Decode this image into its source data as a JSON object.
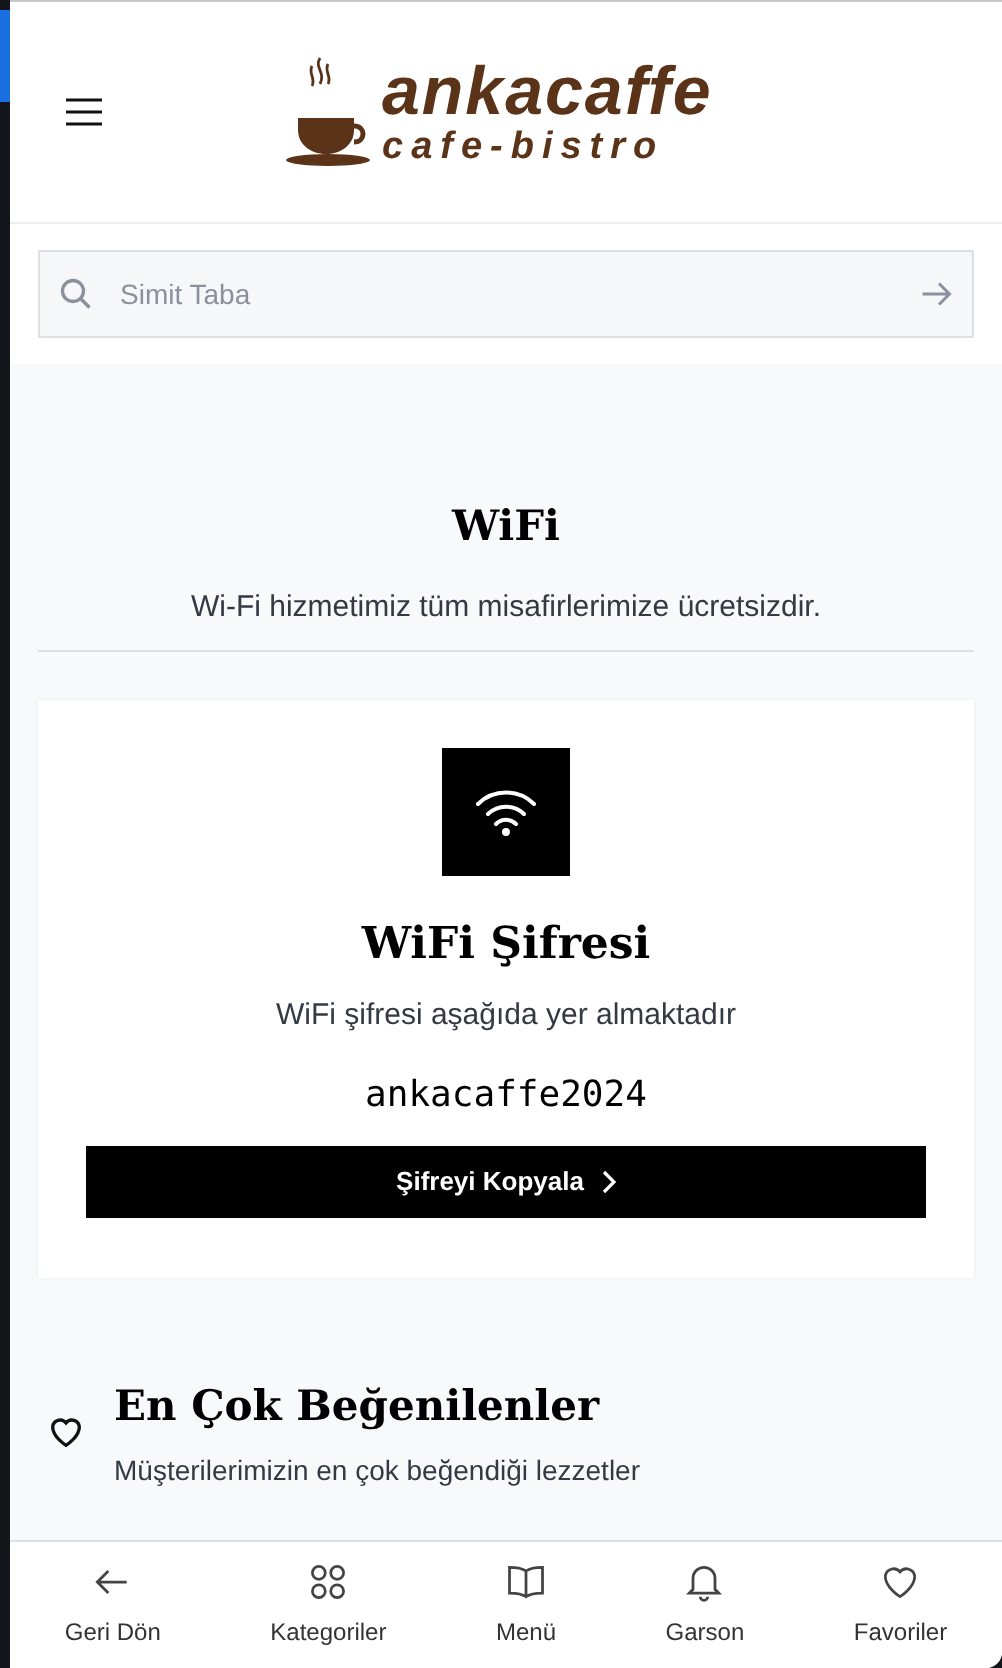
{
  "header": {
    "logo_title": "ankacaffe",
    "logo_subtitle": "cafe-bistro"
  },
  "search": {
    "placeholder": "Simit Taba"
  },
  "wifi_section": {
    "title": "WiFi",
    "subtitle": "Wi-Fi hizmetimiz tüm misafirlerimize ücretsizdir."
  },
  "wifi_card": {
    "title": "WiFi Şifresi",
    "subtitle": "WiFi şifresi aşağıda yer almaktadır",
    "password": "ankacaffe2024",
    "button": "Şifreyi Kopyala"
  },
  "popular_section": {
    "title": "En Çok Beğenilenler",
    "subtitle": "Müşterilerimizin en çok beğendiği lezzetler"
  },
  "bottom_nav": [
    {
      "kind": "back",
      "label": "Geri Dön"
    },
    {
      "kind": "grid",
      "label": "Kategoriler"
    },
    {
      "kind": "book",
      "label": "Menü"
    },
    {
      "kind": "bell",
      "label": "Garson"
    },
    {
      "kind": "heart",
      "label": "Favoriler"
    }
  ]
}
